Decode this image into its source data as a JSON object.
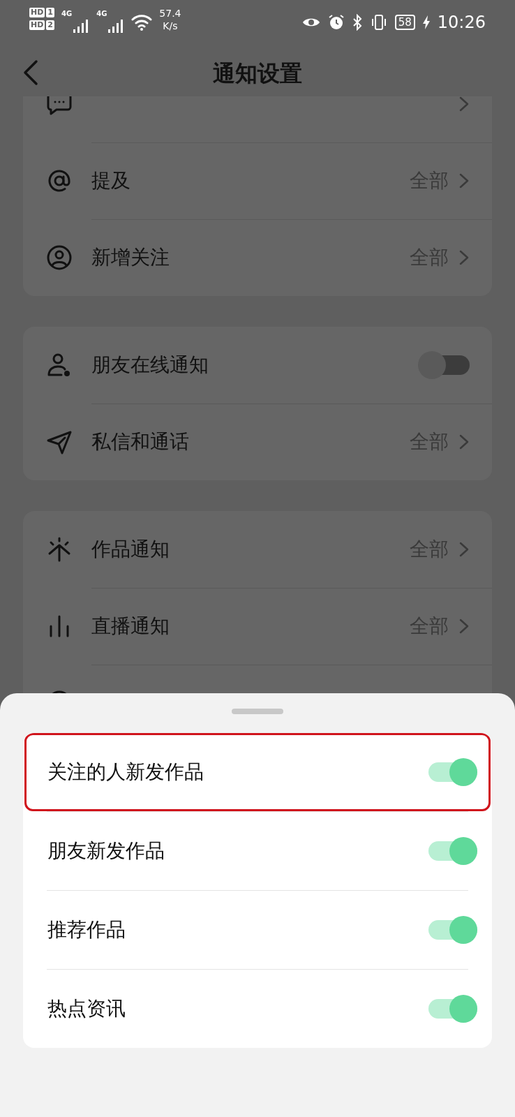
{
  "status_bar": {
    "sim_1": "HD",
    "sim_1_slot": "1",
    "sim_2": "HD",
    "sim_2_slot": "2",
    "network_1": "4G",
    "network_2": "4G",
    "speed": "57.4",
    "speed_unit": "K/s",
    "battery": "58",
    "time": "10:26"
  },
  "header": {
    "title": "通知设置"
  },
  "groups": [
    {
      "rows": [
        {
          "kind": "link"
        },
        {
          "kind": "link",
          "label": "提及",
          "value": "全部"
        },
        {
          "kind": "link",
          "label": "新增关注",
          "value": "全部"
        }
      ]
    },
    {
      "rows": [
        {
          "kind": "toggle",
          "label": "朋友在线通知",
          "on": false
        },
        {
          "kind": "link",
          "label": "私信和通话",
          "value": "全部"
        }
      ]
    },
    {
      "rows": [
        {
          "kind": "link",
          "label": "作品通知",
          "value": "全部"
        },
        {
          "kind": "link",
          "label": "直播通知",
          "value": "全部"
        },
        {
          "kind": "hidden"
        }
      ]
    }
  ],
  "sheet": {
    "rows": [
      {
        "label": "关注的人新发作品",
        "on": true,
        "highlighted": true
      },
      {
        "label": "朋友新发作品",
        "on": true,
        "highlighted": false
      },
      {
        "label": "推荐作品",
        "on": true,
        "highlighted": false
      },
      {
        "label": "热点资讯",
        "on": true,
        "highlighted": false
      }
    ]
  }
}
